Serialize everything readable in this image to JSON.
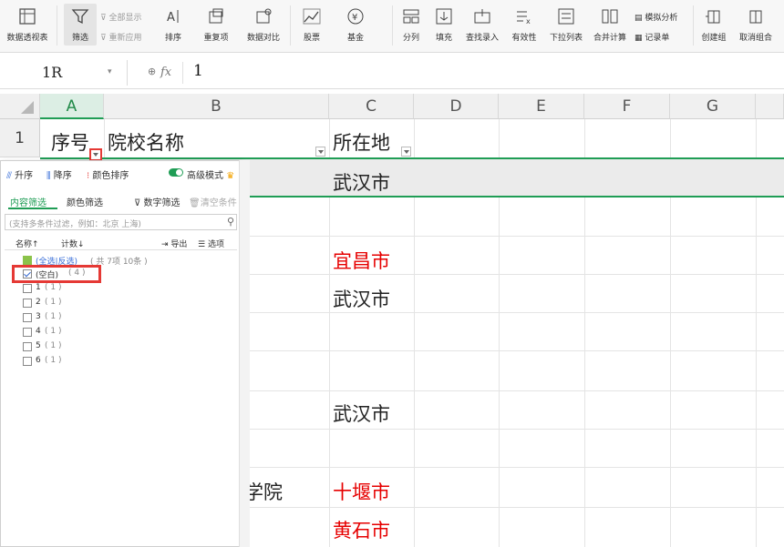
{
  "ribbon": {
    "pivot": "数据透视表",
    "filter": "筛选",
    "show_all": "全部显示",
    "reapply": "重新应用",
    "sort": "排序",
    "duplicates": "重复项",
    "compare": "数据对比",
    "stock": "股票",
    "fund": "基金",
    "split": "分列",
    "fill": "填充",
    "lookup": "查找录入",
    "validity": "有效性",
    "dropdown": "下拉列表",
    "consolidate": "合并计算",
    "whatif": "模拟分析",
    "record": "记录单",
    "group": "创建组",
    "ungroup": "取消组合"
  },
  "formula_bar": {
    "name_box": "1R",
    "fx": "fx",
    "value": "1"
  },
  "columns": [
    "A",
    "B",
    "C",
    "D",
    "E",
    "F",
    "G"
  ],
  "rows": [
    "1"
  ],
  "header_cells": {
    "a": "序号",
    "b": "院校名称",
    "c": "所在地"
  },
  "cells": {
    "c2": "武汉市",
    "c4": "宜昌市",
    "c5": "武汉市",
    "c8": "武汉市",
    "b10_partial": "学院",
    "c10": "十堰市",
    "c11": "黄石市"
  },
  "filter_panel": {
    "asc": "升序",
    "desc": "降序",
    "color_sort": "颜色排序",
    "advanced": "高级模式",
    "tab_content": "内容筛选",
    "tab_color": "颜色筛选",
    "number_filter": "数字筛选",
    "clear": "清空条件",
    "search_placeholder": "(支持多条件过滤，例如：北京 上海)",
    "col_name": "名称↑",
    "col_count": "计数↓",
    "export": "导出",
    "options": "选项",
    "select_all": "(全选|反选)",
    "select_all_count": "( 共 7项 10条 )",
    "items": [
      {
        "label": "(空白)",
        "count": "( 4 )"
      },
      {
        "label": "1",
        "count": "( 1 )"
      },
      {
        "label": "2",
        "count": "( 1 )"
      },
      {
        "label": "3",
        "count": "( 1 )"
      },
      {
        "label": "4",
        "count": "( 1 )"
      },
      {
        "label": "5",
        "count": "( 1 )"
      },
      {
        "label": "6",
        "count": "( 1 )"
      }
    ]
  },
  "colors": {
    "accent_green": "#1f9d55",
    "highlight_red": "#e53935",
    "text_red": "#e60000"
  }
}
